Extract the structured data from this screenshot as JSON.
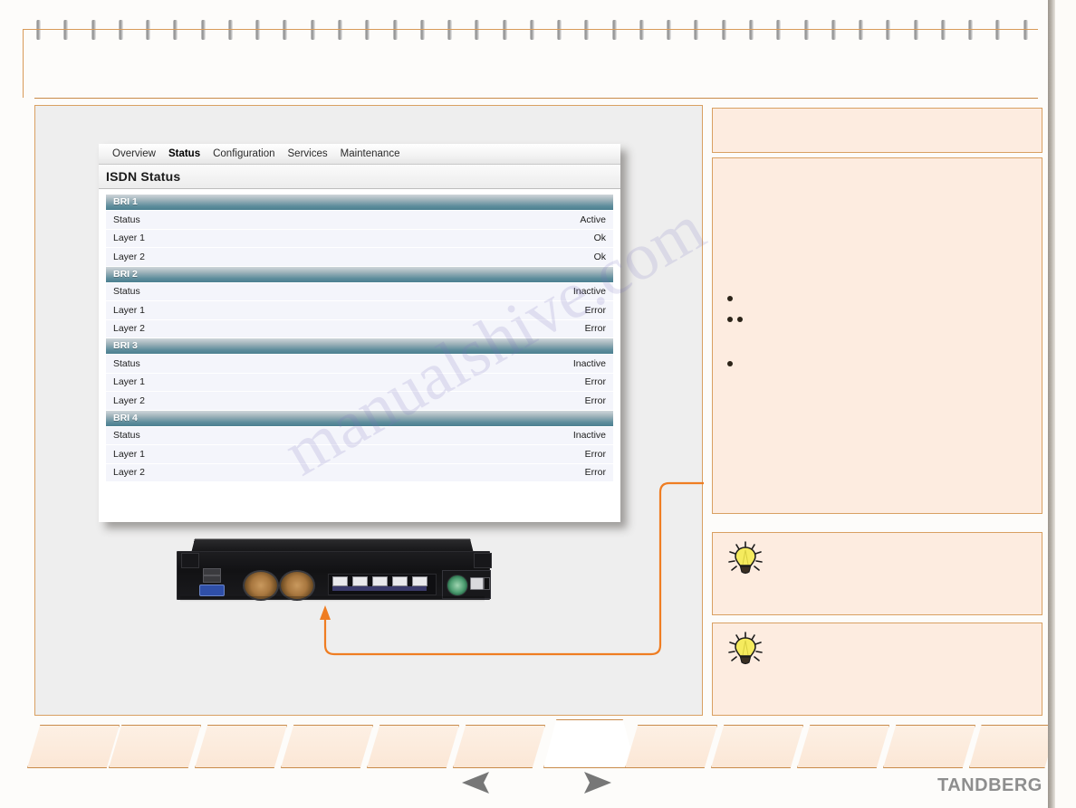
{
  "document": {
    "brand_logo": "TANDBERG",
    "watermark": "manualshive.com"
  },
  "browser": {
    "nav_tabs": [
      {
        "label": "Overview",
        "active": false
      },
      {
        "label": "Status",
        "active": true
      },
      {
        "label": "Configuration",
        "active": false
      },
      {
        "label": "Services",
        "active": false
      },
      {
        "label": "Maintenance",
        "active": false
      }
    ],
    "page_title": "ISDN Status",
    "groups": [
      {
        "header": "BRI 1",
        "rows": [
          {
            "label": "Status",
            "value": "Active"
          },
          {
            "label": "Layer 1",
            "value": "Ok"
          },
          {
            "label": "Layer 2",
            "value": "Ok"
          }
        ]
      },
      {
        "header": "BRI 2",
        "rows": [
          {
            "label": "Status",
            "value": "Inactive"
          },
          {
            "label": "Layer 1",
            "value": "Error"
          },
          {
            "label": "Layer 2",
            "value": "Error"
          }
        ]
      },
      {
        "header": "BRI 3",
        "rows": [
          {
            "label": "Status",
            "value": "Inactive"
          },
          {
            "label": "Layer 1",
            "value": "Error"
          },
          {
            "label": "Layer 2",
            "value": "Error"
          }
        ]
      },
      {
        "header": "BRI 4",
        "rows": [
          {
            "label": "Status",
            "value": "Inactive"
          },
          {
            "label": "Layer 1",
            "value": "Error"
          },
          {
            "label": "Layer 2",
            "value": "Error"
          }
        ]
      }
    ]
  },
  "sidebar": {
    "panels": [
      {
        "name": "panel-1",
        "text": ""
      },
      {
        "name": "panel-2",
        "text": ""
      },
      {
        "name": "panel-3",
        "text": "",
        "icon": "lightbulb-icon"
      },
      {
        "name": "panel-4",
        "text": "",
        "icon": "lightbulb-icon"
      }
    ]
  },
  "footer": {
    "prev_icon": "triangle-left-icon",
    "next_icon": "triangle-right-icon",
    "tab_count": 12
  },
  "colors": {
    "accent_orange": "#d9a062",
    "panel_bg": "#fdece0",
    "table_header_teal": "#4b7f90",
    "row_bg": "#f4f5fb",
    "callout_orange": "#ef7d22",
    "logo_gray": "#8e8e8e"
  }
}
